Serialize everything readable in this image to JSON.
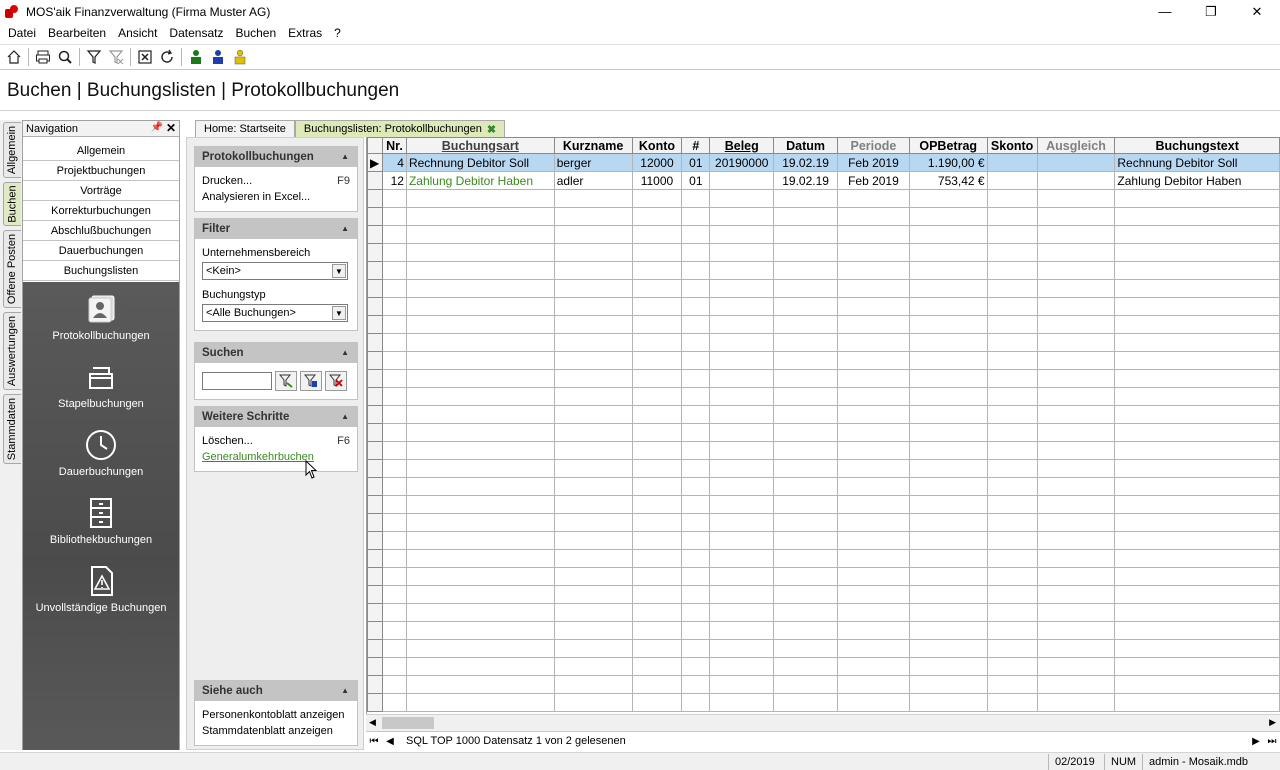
{
  "window": {
    "title": "MOS'aik Finanzverwaltung (Firma Muster AG)",
    "controls": {
      "minimize": "—",
      "restore": "❐",
      "close": "✕"
    }
  },
  "menu": {
    "items": [
      {
        "label": "Datei"
      },
      {
        "label": "Bearbeiten"
      },
      {
        "label": "Ansicht"
      },
      {
        "label": "Datensatz"
      },
      {
        "label": "Buchen"
      },
      {
        "label": "Extras"
      },
      {
        "label": "?"
      }
    ]
  },
  "page": {
    "heading": "Buchen | Buchungslisten | Protokollbuchungen"
  },
  "left_tabs": [
    "Allgemein",
    "Buchen",
    "Offene Posten",
    "Auswertungen",
    "Stammdaten"
  ],
  "navigation": {
    "header": "Navigation",
    "items": [
      {
        "label": "Allgemein"
      },
      {
        "label": "Projektbuchungen"
      },
      {
        "label": "Vorträge"
      },
      {
        "label": "Korrekturbuchungen"
      },
      {
        "label": "Abschlußbuchungen"
      },
      {
        "label": "Dauerbuchungen"
      },
      {
        "label": "Buchungslisten"
      }
    ],
    "big_items": [
      {
        "label": "Protokollbuchungen"
      },
      {
        "label": "Stapelbuchungen"
      },
      {
        "label": "Dauerbuchungen"
      },
      {
        "label": "Bibliothekbuchungen"
      },
      {
        "label": "Unvollständige Buchungen"
      }
    ]
  },
  "doc_tabs": [
    {
      "label": "Home: Startseite"
    },
    {
      "label": "Buchungslisten: Protokollbuchungen",
      "close": "✖"
    }
  ],
  "tasks": {
    "protokoll": {
      "title": "Protokollbuchungen",
      "rows": [
        {
          "label": "Drucken...",
          "key": "F9"
        },
        {
          "label": "Analysieren in Excel...",
          "key": ""
        }
      ]
    },
    "filter": {
      "title": "Filter",
      "bereich_label": "Unternehmensbereich",
      "bereich_value": "<Kein>",
      "typ_label": "Buchungstyp",
      "typ_value": "<Alle Buchungen>"
    },
    "suchen": {
      "title": "Suchen"
    },
    "weitere": {
      "title": "Weitere Schritte",
      "rows": [
        {
          "label": "Löschen...",
          "key": "F6"
        }
      ],
      "link": "Generalumkehrbuchen"
    },
    "siehe": {
      "title": "Siehe auch",
      "rows": [
        {
          "label": "Personenkontoblatt anzeigen"
        },
        {
          "label": "Stammdatenblatt anzeigen"
        }
      ]
    }
  },
  "grid": {
    "columns": [
      "Nr.",
      "Buchungsart",
      "Kurzname",
      "Konto",
      "#",
      "Beleg",
      "Datum",
      "Periode",
      "OPBetrag",
      "Skonto",
      "Ausgleich",
      "Buchungstext"
    ],
    "rows": [
      {
        "nr": "4",
        "buchungsart": "Rechnung Debitor Soll",
        "kurzname": "berger",
        "konto": "12000",
        "num": "01",
        "beleg": "20190000",
        "datum": "19.02.19",
        "periode": "Feb 2019",
        "opbetrag": "1.190,00 €",
        "skonto": "",
        "ausgleich": "",
        "buchungstext": "Rechnung Debitor Soll"
      },
      {
        "nr": "12",
        "buchungsart": "Zahlung Debitor Haben",
        "kurzname": "adler",
        "konto": "11000",
        "num": "01",
        "beleg": "",
        "datum": "19.02.19",
        "periode": "Feb 2019",
        "opbetrag": "753,42 €",
        "skonto": "",
        "ausgleich": "",
        "buchungstext": "Zahlung Debitor Haben"
      }
    ]
  },
  "record_nav": {
    "text": "SQL TOP 1000 Datensatz 1 von 2 gelesenen"
  },
  "status": {
    "period": "02/2019",
    "num": "NUM",
    "user": "admin - Mosaik.mdb"
  },
  "colors": {
    "accent_green": "#3a8a1f",
    "selection": "#b8d8f2",
    "nav_dark": "#4f4f4f"
  }
}
